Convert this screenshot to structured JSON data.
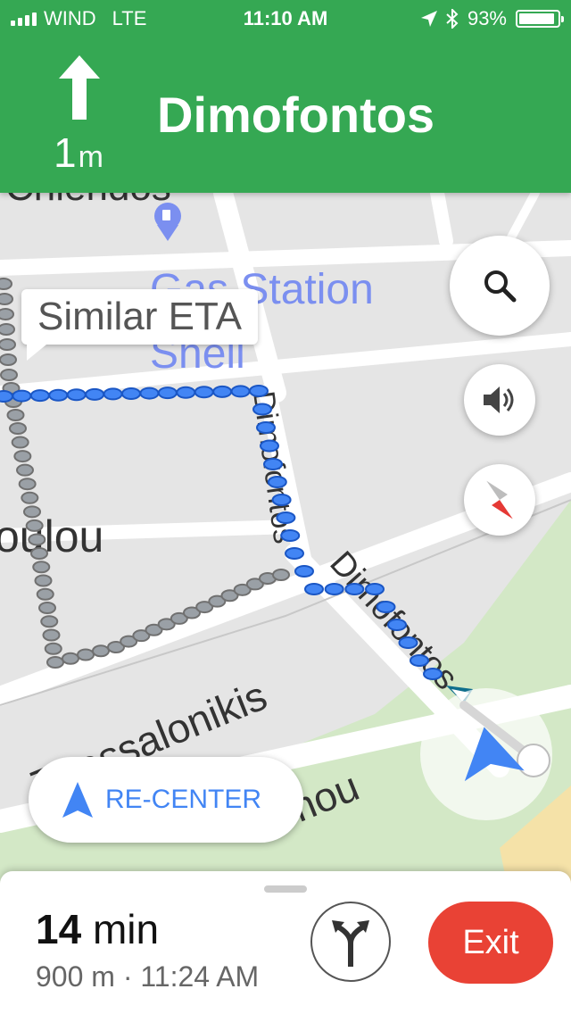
{
  "status_bar": {
    "carrier": "WIND",
    "network": "LTE",
    "time": "11:10 AM",
    "battery": "93%",
    "battery_level": 0.93
  },
  "navigation": {
    "distance_value": "1",
    "distance_unit": "m",
    "street": "Dimofontos",
    "turn_icon": "straight-arrow-icon",
    "header_color": "#35a853"
  },
  "map": {
    "labels": {
      "top_cut": "Chlendos",
      "gas_station": "Gas Station",
      "shell": "Shell",
      "poulou": "oulou",
      "dimofontos_vertical": "Dimofontos",
      "dimofontos_diagonal": "Dimofontos",
      "thessalonikis": "Thessalonikis",
      "armou": "Ermou"
    },
    "route_color": "#4285f4",
    "alt_route_color": "#9aa0a6"
  },
  "tooltip": {
    "text": "Similar ETA"
  },
  "buttons": {
    "search_icon": "search-icon",
    "sound_icon": "volume-icon",
    "compass_icon": "compass-icon",
    "recenter_label": "RE-CENTER"
  },
  "trip": {
    "minutes": "14",
    "minutes_unit": "min",
    "details": "900 m · 11:24 AM",
    "exit_label": "Exit",
    "exit_color": "#e94235"
  }
}
